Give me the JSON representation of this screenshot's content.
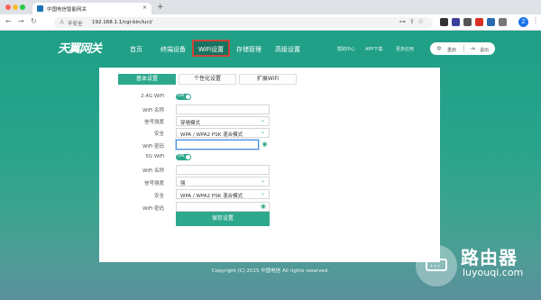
{
  "browser": {
    "tab_title": "中国电信智能网关",
    "tab_close": "×",
    "new_tab": "+",
    "insecure_label": "不安全",
    "url": "192.168.1.1/cgi-bin/luci/",
    "profile_initial": "Z"
  },
  "header": {
    "logo": "天翼网关",
    "nav": [
      "首页",
      "终端设备",
      "WiFi设置",
      "存储管理",
      "高级设置"
    ],
    "active_nav": "WiFi设置",
    "links": [
      "帮助中心",
      "APP下载",
      "更多应用"
    ],
    "restart_label": "重启",
    "logout_label": "退出"
  },
  "tabs": [
    "基本设置",
    "个性化设置",
    "扩展WiFi"
  ],
  "active_tab": "基本设置",
  "wifi24": {
    "label": "2.4G WiFi",
    "toggle": "ON",
    "name_label": "WiFi 名称",
    "name_value": "",
    "signal_label": "信号强度",
    "signal_value": "穿墙模式",
    "security_label": "安全",
    "security_value": "WPA / WPA2 PSK 混合模式",
    "password_label": "WiFi 密码",
    "password_value": ""
  },
  "wifi5": {
    "label": "5G WiFi",
    "toggle": "ON",
    "name_label": "WiFi 名称",
    "name_value": "",
    "signal_label": "信号强度",
    "signal_value": "强",
    "security_label": "安全",
    "security_value": "WPA / WPA2 PSK 混合模式",
    "password_label": "WiFi 密码",
    "password_value": ""
  },
  "save_label": "保存设置",
  "footer": "Copyright (C) 2015 中国电信 All rights reserved.",
  "watermark": {
    "cn": "路由器",
    "en": "luyouqi.com"
  },
  "colors": {
    "primary": "#2ea88c",
    "header_bg": "#1f9f86",
    "active_outline": "#c9453b"
  }
}
